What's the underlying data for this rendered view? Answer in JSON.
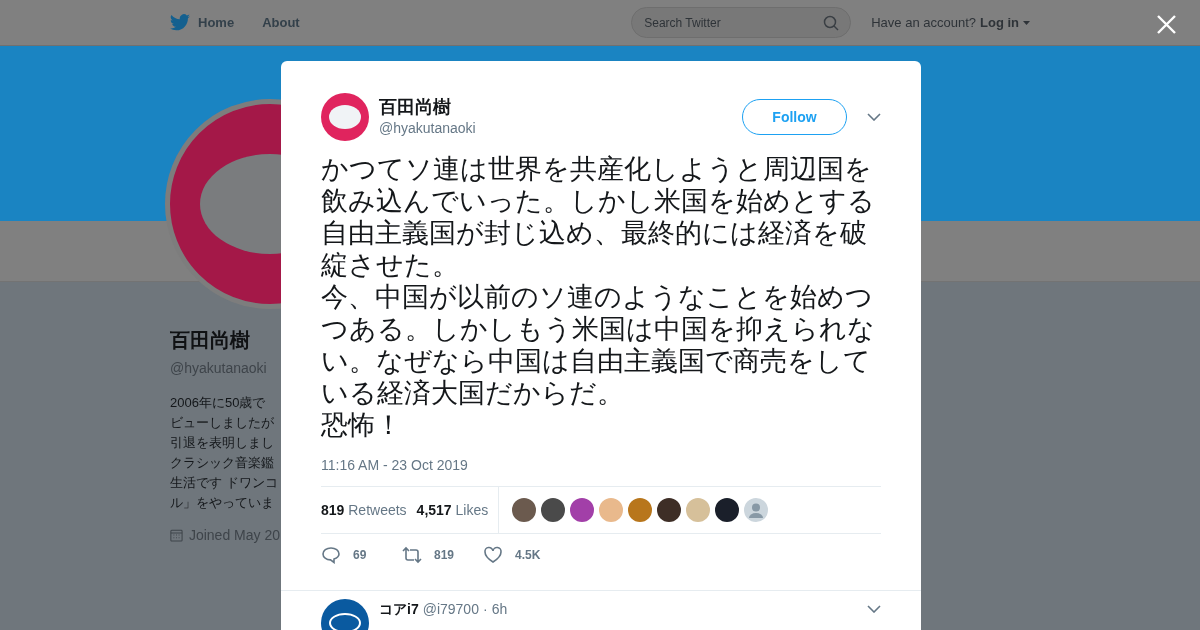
{
  "header": {
    "nav": [
      {
        "kind": "home",
        "label": "Home"
      },
      {
        "kind": "link",
        "label": "About"
      }
    ],
    "search": {
      "placeholder": "Search Twitter"
    },
    "account_prompt": "Have an account?",
    "login": "Log in"
  },
  "profile": {
    "name": "百田尚樹",
    "handle": "@hyakutanaoki",
    "bio_lines": [
      "2006年に50歳で",
      "ビューしましたが",
      "引退を表明しまし",
      "クラシック音楽鑑",
      "生活です ドワンコ",
      "ル」をやっていま"
    ],
    "joined": "Joined May 20"
  },
  "tweet": {
    "author": {
      "name": "百田尚樹",
      "handle": "@hyakutanaoki"
    },
    "follow_label": "Follow",
    "paragraphs": [
      "かつてソ連は世界を共産化しようと周辺国を飲み込んでいった。しかし米国を始めとする自由主義国が封じ込め、最終的には経済を破綻させた。",
      "今、中国が以前のソ連のようなことを始めつつある。しかしもう米国は中国を抑えられない。なぜなら中国は自由主義国で商売をしている経済大国だからだ。",
      "恐怖！"
    ],
    "timestamp": "11:16 AM - 23 Oct 2019",
    "stats": [
      {
        "count": "819",
        "label": "Retweets"
      },
      {
        "count": "4,517",
        "label": "Likes"
      }
    ],
    "liker_avatars": [
      {
        "kind": "photo",
        "color": "#6b5a4e"
      },
      {
        "kind": "photo",
        "color": "#4a4a4a"
      },
      {
        "kind": "photo",
        "color": "#a23fa8"
      },
      {
        "kind": "photo",
        "color": "#e9b98c"
      },
      {
        "kind": "photo",
        "color": "#b8761c"
      },
      {
        "kind": "photo",
        "color": "#3e2e26"
      },
      {
        "kind": "photo",
        "color": "#d6c09a"
      },
      {
        "kind": "photo",
        "color": "#1a1f2a"
      },
      {
        "kind": "default",
        "color": "#ccd6dd"
      }
    ],
    "actions": [
      {
        "kind": "reply",
        "count": "69"
      },
      {
        "kind": "retweet",
        "count": "819"
      },
      {
        "kind": "like",
        "count": "4.5K"
      }
    ]
  },
  "reply": {
    "name": "コアi7",
    "handle": "@i79700",
    "separator": "·",
    "time": "6h"
  }
}
